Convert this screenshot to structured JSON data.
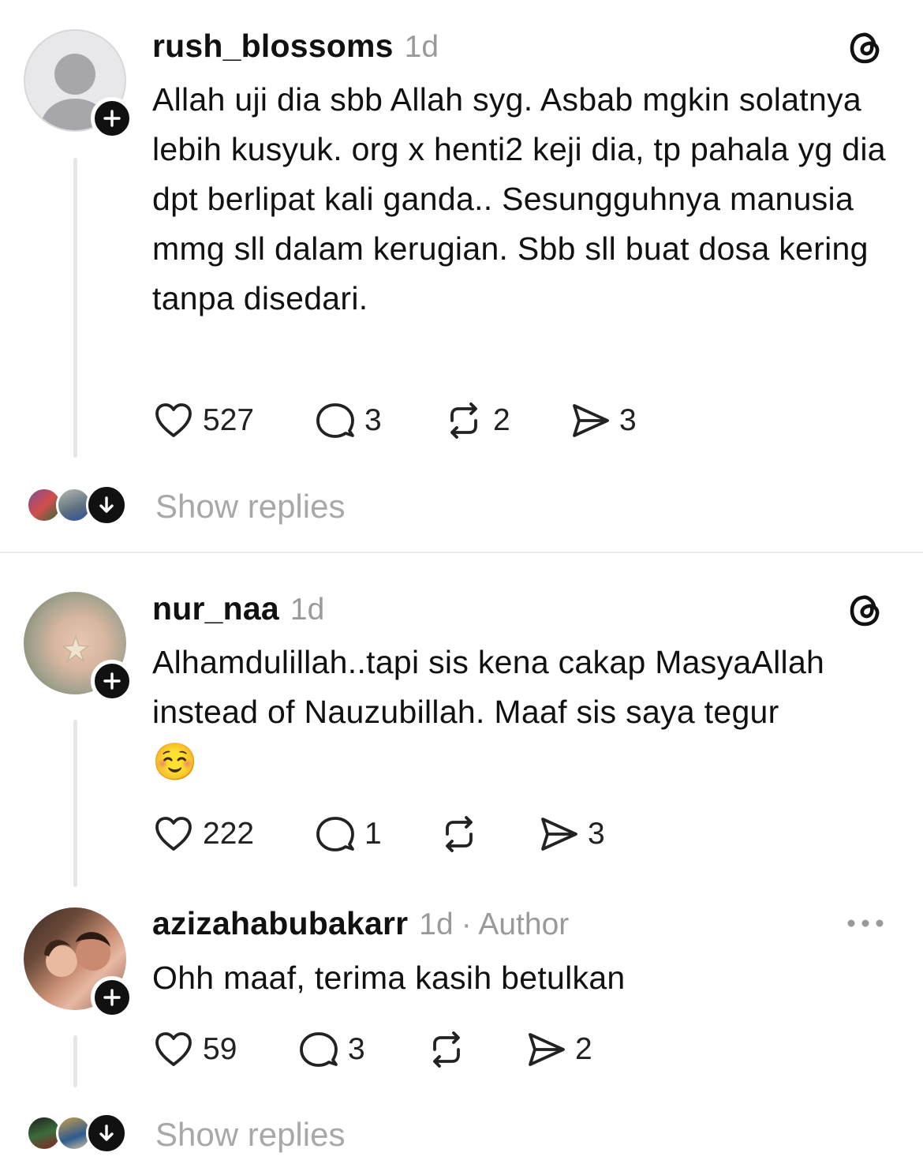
{
  "post1": {
    "username": "rush_blossoms",
    "time": "1d",
    "text": "Allah uji dia sbb Allah syg. Asbab mgkin solatnya lebih kusyuk.  org x henti2 keji dia, tp pahala yg dia dpt berlipat kali ganda.. Sesungguhnya manusia mmg sll dalam kerugian. Sbb sll buat dosa kering tanpa disedari.",
    "likes": "527",
    "replies": "3",
    "reposts": "2",
    "shares": "3",
    "show_replies": "Show replies"
  },
  "post2": {
    "username": "nur_naa",
    "time": "1d",
    "text": "Alhamdulillah..tapi sis kena cakap MasyaAllah instead of Nauzubillah. Maaf sis saya tegur",
    "emoji": "☺️",
    "likes": "222",
    "replies": "1",
    "shares": "3"
  },
  "reply": {
    "username": "azizahabubakarr",
    "time": "1d",
    "author_tag": "· Author",
    "text": "Ohh maaf, terima kasih betulkan",
    "likes": "59",
    "replies": "3",
    "shares": "2",
    "show_replies": "Show replies"
  },
  "icons": {
    "threads": "threads-logo-icon",
    "more": "more-horizontal-icon",
    "follow": "plus-icon",
    "like": "heart-icon",
    "reply": "comment-icon",
    "repost": "repost-icon",
    "share": "send-icon",
    "expand": "arrow-down-icon"
  }
}
